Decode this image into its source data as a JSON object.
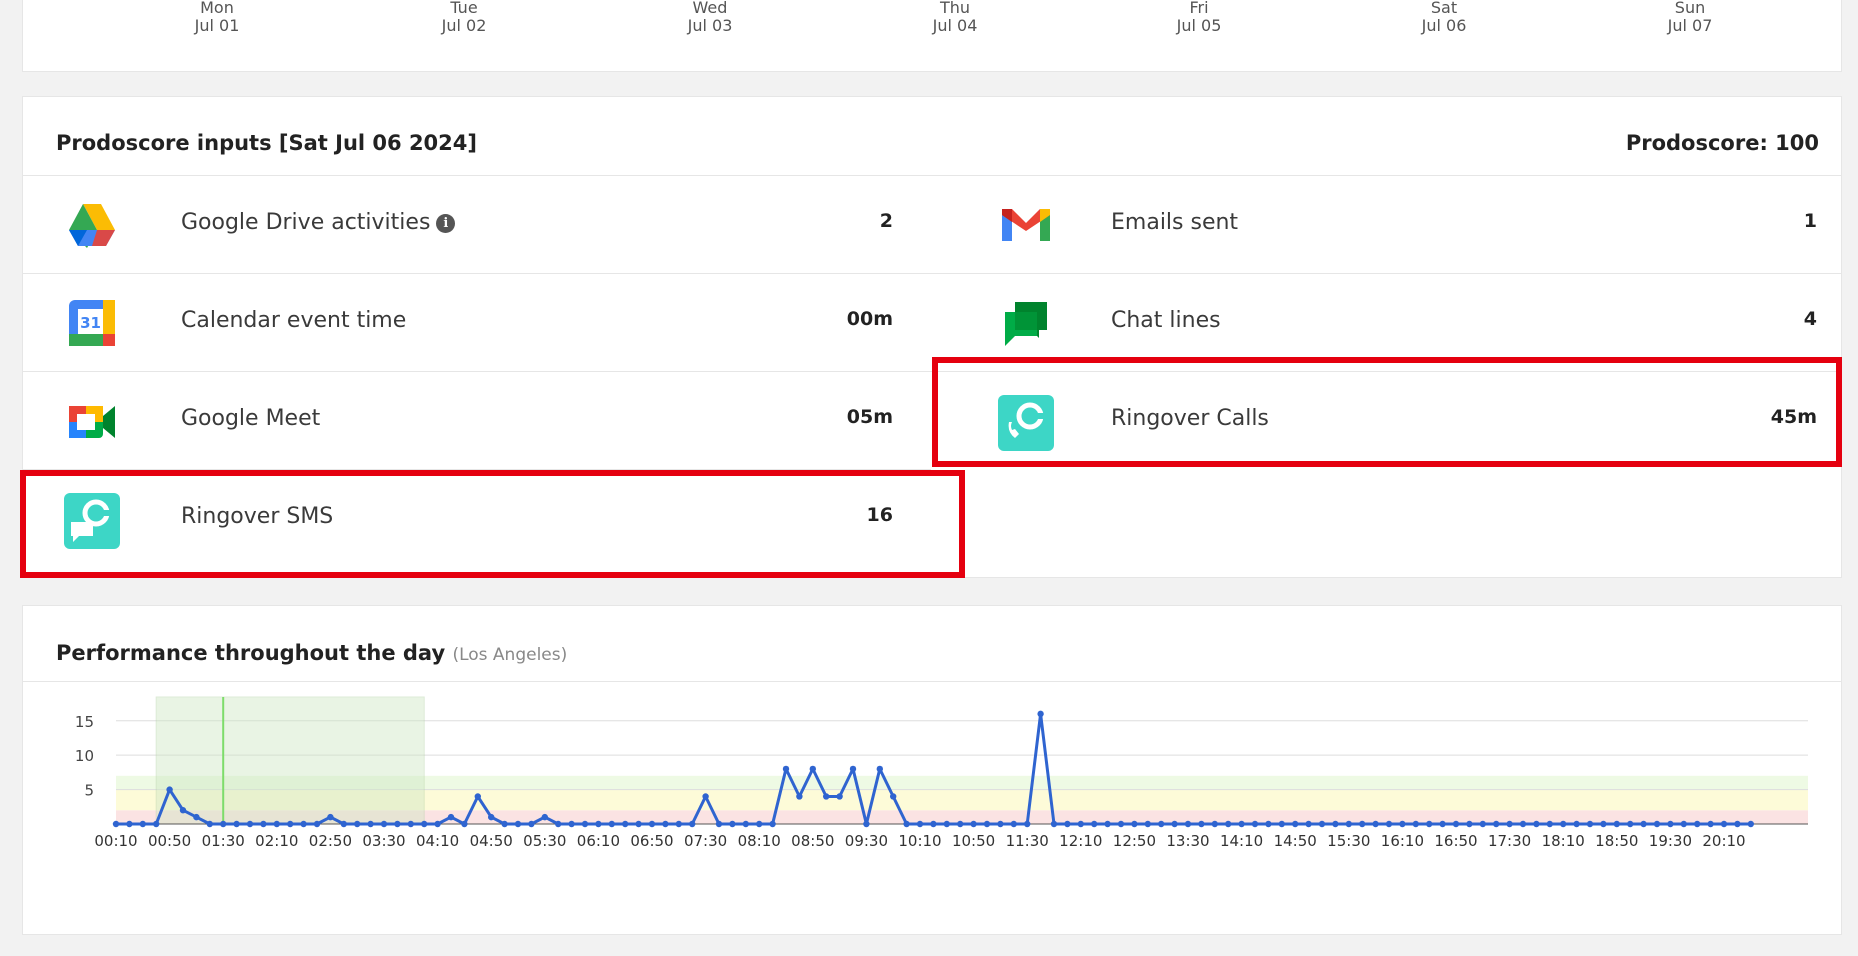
{
  "week_axis": {
    "days": [
      {
        "name": "Mon",
        "date": "Jul 01"
      },
      {
        "name": "Tue",
        "date": "Jul 02"
      },
      {
        "name": "Wed",
        "date": "Jul 03"
      },
      {
        "name": "Thu",
        "date": "Jul 04"
      },
      {
        "name": "Fri",
        "date": "Jul 05"
      },
      {
        "name": "Sat",
        "date": "Jul 06"
      },
      {
        "name": "Sun",
        "date": "Jul 07"
      }
    ]
  },
  "inputs": {
    "title": "Prodoscore inputs [Sat Jul 06 2024]",
    "score_label": "Prodoscore: 100",
    "metrics": [
      {
        "label": "Google Drive activities",
        "value": "2",
        "icon": "google-drive-icon"
      },
      {
        "label": "Emails sent",
        "value": "1",
        "icon": "gmail-icon"
      },
      {
        "label": "Calendar event time",
        "value": "00m",
        "icon": "google-calendar-icon"
      },
      {
        "label": "Chat lines",
        "value": "4",
        "icon": "google-chat-icon"
      },
      {
        "label": "Google Meet",
        "value": "05m",
        "icon": "google-meet-icon"
      },
      {
        "label": "Ringover Calls",
        "value": "45m",
        "icon": "ringover-icon"
      },
      {
        "label": "Ringover SMS",
        "value": "16",
        "icon": "ringover-icon"
      }
    ],
    "calendar_icon_text": "31",
    "info_icon_text": "i"
  },
  "performance": {
    "title": "Performance throughout the day",
    "subtitle": "(Los Angeles)"
  },
  "chart_data": {
    "type": "line",
    "x": [
      "00:10",
      "00:20",
      "00:30",
      "00:40",
      "00:50",
      "01:00",
      "01:10",
      "01:20",
      "01:30",
      "01:40",
      "01:50",
      "02:00",
      "02:10",
      "02:20",
      "02:30",
      "02:40",
      "02:50",
      "03:00",
      "03:10",
      "03:20",
      "03:30",
      "03:40",
      "03:50",
      "04:00",
      "04:10",
      "04:20",
      "04:30",
      "04:40",
      "04:50",
      "05:00",
      "05:10",
      "05:20",
      "05:30",
      "05:40",
      "05:50",
      "06:00",
      "06:10",
      "06:20",
      "06:30",
      "06:40",
      "06:50",
      "07:00",
      "07:10",
      "07:20",
      "07:30",
      "07:40",
      "07:50",
      "08:00",
      "08:10",
      "08:20",
      "08:30",
      "08:40",
      "08:50",
      "09:00",
      "09:10",
      "09:20",
      "09:30",
      "09:40",
      "09:50",
      "10:00",
      "10:10",
      "10:20",
      "10:30",
      "10:40",
      "10:50",
      "11:00",
      "11:10",
      "11:20",
      "11:30",
      "11:40",
      "11:50",
      "12:00",
      "12:10",
      "12:20",
      "12:30",
      "12:40",
      "12:50",
      "13:00",
      "13:10",
      "13:20",
      "13:30",
      "13:40",
      "13:50",
      "14:00",
      "14:10",
      "14:20",
      "14:30",
      "14:40",
      "14:50",
      "15:00",
      "15:10",
      "15:20",
      "15:30",
      "15:40",
      "15:50",
      "16:00",
      "16:10",
      "16:20",
      "16:30",
      "16:40",
      "16:50",
      "17:00",
      "17:10",
      "17:20",
      "17:30",
      "17:40",
      "17:50",
      "18:00",
      "18:10",
      "18:20",
      "18:30",
      "18:40",
      "18:50",
      "19:00",
      "19:10",
      "19:20",
      "19:30",
      "19:40",
      "19:50",
      "20:00",
      "20:10",
      "20:20",
      "20:30"
    ],
    "values": [
      0,
      0,
      0,
      0,
      5,
      2,
      1,
      0,
      0,
      0,
      0,
      0,
      0,
      0,
      0,
      0,
      1,
      0,
      0,
      0,
      0,
      0,
      0,
      0,
      0,
      1,
      0,
      4,
      1,
      0,
      0,
      0,
      1,
      0,
      0,
      0,
      0,
      0,
      0,
      0,
      0,
      0,
      0,
      0,
      4,
      0,
      0,
      0,
      0,
      0,
      8,
      4,
      8,
      4,
      4,
      8,
      0,
      8,
      4,
      0,
      0,
      0,
      0,
      0,
      0,
      0,
      0,
      0,
      0,
      16,
      0,
      0,
      0,
      0,
      0,
      0,
      0,
      0,
      0,
      0,
      0,
      0,
      0,
      0,
      0,
      0,
      0,
      0,
      0,
      0,
      0,
      0,
      0,
      0,
      0,
      0,
      0,
      0,
      0,
      0,
      0,
      0,
      0,
      0,
      0,
      0,
      0,
      0,
      0,
      0,
      0,
      0,
      0,
      0,
      0,
      0,
      0,
      0,
      0,
      0,
      0,
      0,
      0
    ],
    "x_tick_labels": [
      "00:10",
      "00:50",
      "01:30",
      "02:10",
      "02:50",
      "03:30",
      "04:10",
      "04:50",
      "05:30",
      "06:10",
      "06:50",
      "07:30",
      "08:10",
      "08:50",
      "09:30",
      "10:10",
      "10:50",
      "11:30",
      "12:10",
      "12:50",
      "13:30",
      "14:10",
      "14:50",
      "15:30",
      "16:10",
      "16:50",
      "17:30",
      "18:10",
      "18:50",
      "19:30",
      "20:10"
    ],
    "y_ticks": [
      5,
      10,
      15
    ],
    "ylim": [
      0,
      17
    ],
    "grid": true,
    "bands": [
      {
        "from": 0,
        "to": 2,
        "color": "#fbe3e3"
      },
      {
        "from": 2,
        "to": 5,
        "color": "#fdfbd8"
      },
      {
        "from": 5,
        "to": 7,
        "color": "#eefae4"
      }
    ],
    "highlight_range": [
      "00:40",
      "04:00"
    ],
    "marker_time": "01:30",
    "line_color": "#2f64d0",
    "grid_color": "#dddddd"
  }
}
